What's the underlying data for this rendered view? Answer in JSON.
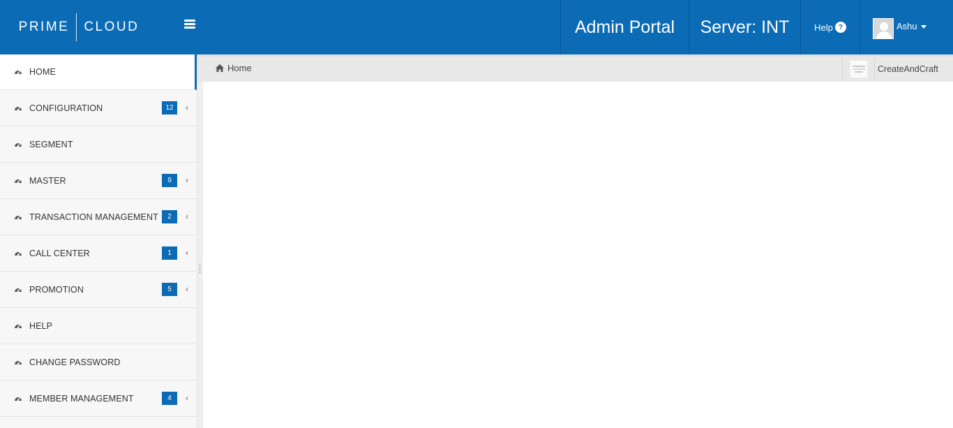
{
  "header": {
    "logo_left": "PRIME",
    "logo_right": "CLOUD",
    "admin_portal": "Admin Portal",
    "server": "Server: INT",
    "help": "Help",
    "help_badge": "?",
    "user": "Ashu"
  },
  "sidebar": {
    "items": [
      {
        "label": "HOME",
        "badge": "",
        "active": true
      },
      {
        "label": "CONFIGURATION",
        "badge": "12"
      },
      {
        "label": "SEGMENT",
        "badge": ""
      },
      {
        "label": "MASTER",
        "badge": "9"
      },
      {
        "label": "TRANSACTION MANAGEMENT",
        "badge": "2"
      },
      {
        "label": "CALL CENTER",
        "badge": "1"
      },
      {
        "label": "PROMOTION",
        "badge": "5"
      },
      {
        "label": "HELP",
        "badge": ""
      },
      {
        "label": "CHANGE PASSWORD",
        "badge": ""
      },
      {
        "label": "MEMBER MANAGEMENT",
        "badge": "4"
      }
    ],
    "item_icon": "dashboard-icon",
    "chevron_icon": "chevron-left-icon"
  },
  "breadcrumb": {
    "home": "Home"
  },
  "company": {
    "name": "CreateAndCraft"
  },
  "colors": {
    "brand": "#0b6bb5",
    "sidebar_bg": "#f7f7f7",
    "crumb_bg": "#e8e8e8"
  }
}
